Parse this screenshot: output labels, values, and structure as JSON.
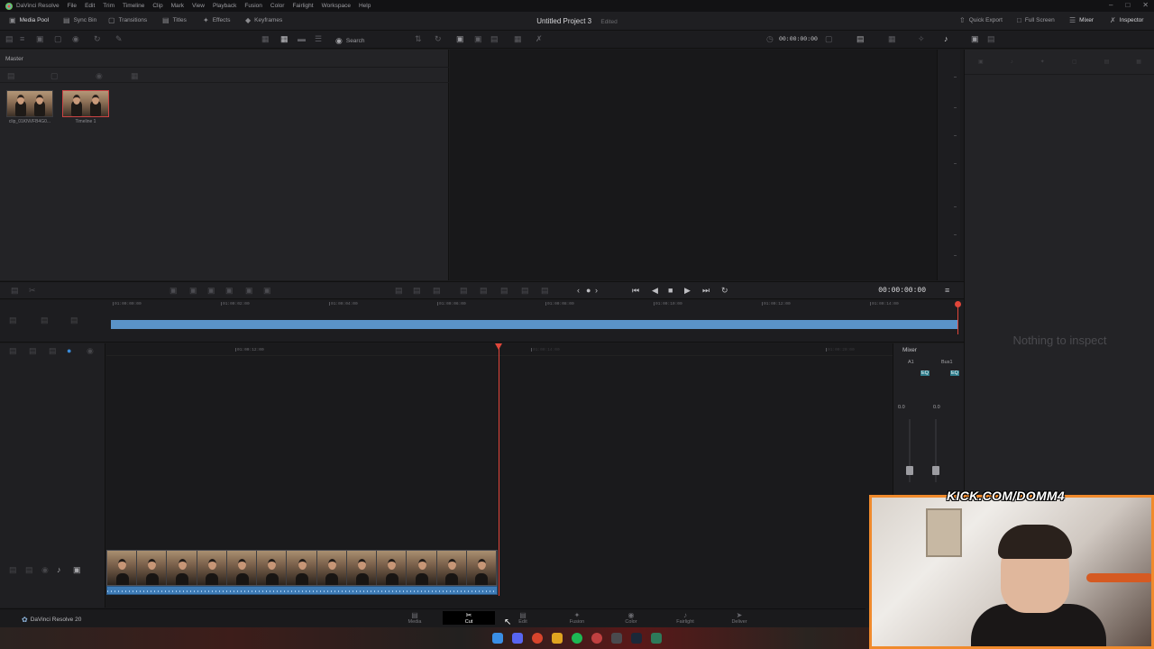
{
  "menubar": {
    "items": [
      "DaVinci Resolve",
      "File",
      "Edit",
      "Trim",
      "Timeline",
      "Clip",
      "Mark",
      "View",
      "Playback",
      "Fusion",
      "Color",
      "Fairlight",
      "Workspace",
      "Help"
    ]
  },
  "toolbar": {
    "left_buttons": [
      "Media Pool",
      "Sync Bin",
      "Transitions",
      "Titles",
      "Effects",
      "Keyframes"
    ],
    "project_title": "Untitled Project 3",
    "project_status": "Edited",
    "right_buttons": [
      "Quick Export",
      "Full Screen",
      "Mixer",
      "Inspector"
    ]
  },
  "toolbar2": {
    "search_label": "Search",
    "viewer_timecode": "00:00:00:00"
  },
  "media_pool": {
    "bin": "Master",
    "clips": [
      {
        "label": "clip_01KNVFB4G0..."
      },
      {
        "label": "Timeline 1"
      }
    ]
  },
  "transport": {
    "timecode": "00:00:00:00"
  },
  "upper_timeline": {
    "ticks": [
      "01:00:00:00",
      "01:00:02:00",
      "01:00:04:00",
      "01:00:06:00",
      "01:00:08:00",
      "01:00:10:00",
      "01:00:12:00",
      "01:00:14:00"
    ]
  },
  "lower_timeline": {
    "ticks": [
      "01:00:12:00",
      "01:00:14:00",
      "01:00:20:00"
    ]
  },
  "inspector": {
    "empty_text": "Nothing to inspect"
  },
  "mixer": {
    "title": "Mixer",
    "channels": [
      "A1",
      "Bus1"
    ],
    "eq_labels": [
      "EQ",
      "EQ"
    ],
    "levels": [
      "0.0",
      "0.0"
    ]
  },
  "pagebar": {
    "app_name": "DaVinci Resolve 20",
    "pages": [
      "Media",
      "Cut",
      "Edit",
      "Fusion",
      "Color",
      "Fairlight",
      "Deliver"
    ],
    "active_page": "Cut"
  },
  "overlay": {
    "banner": "KICK.COM/DOMM4"
  },
  "colors": {
    "accent_blue": "#5a93c8",
    "playhead_red": "#e0463a",
    "webcam_border": "#f08a2c"
  }
}
